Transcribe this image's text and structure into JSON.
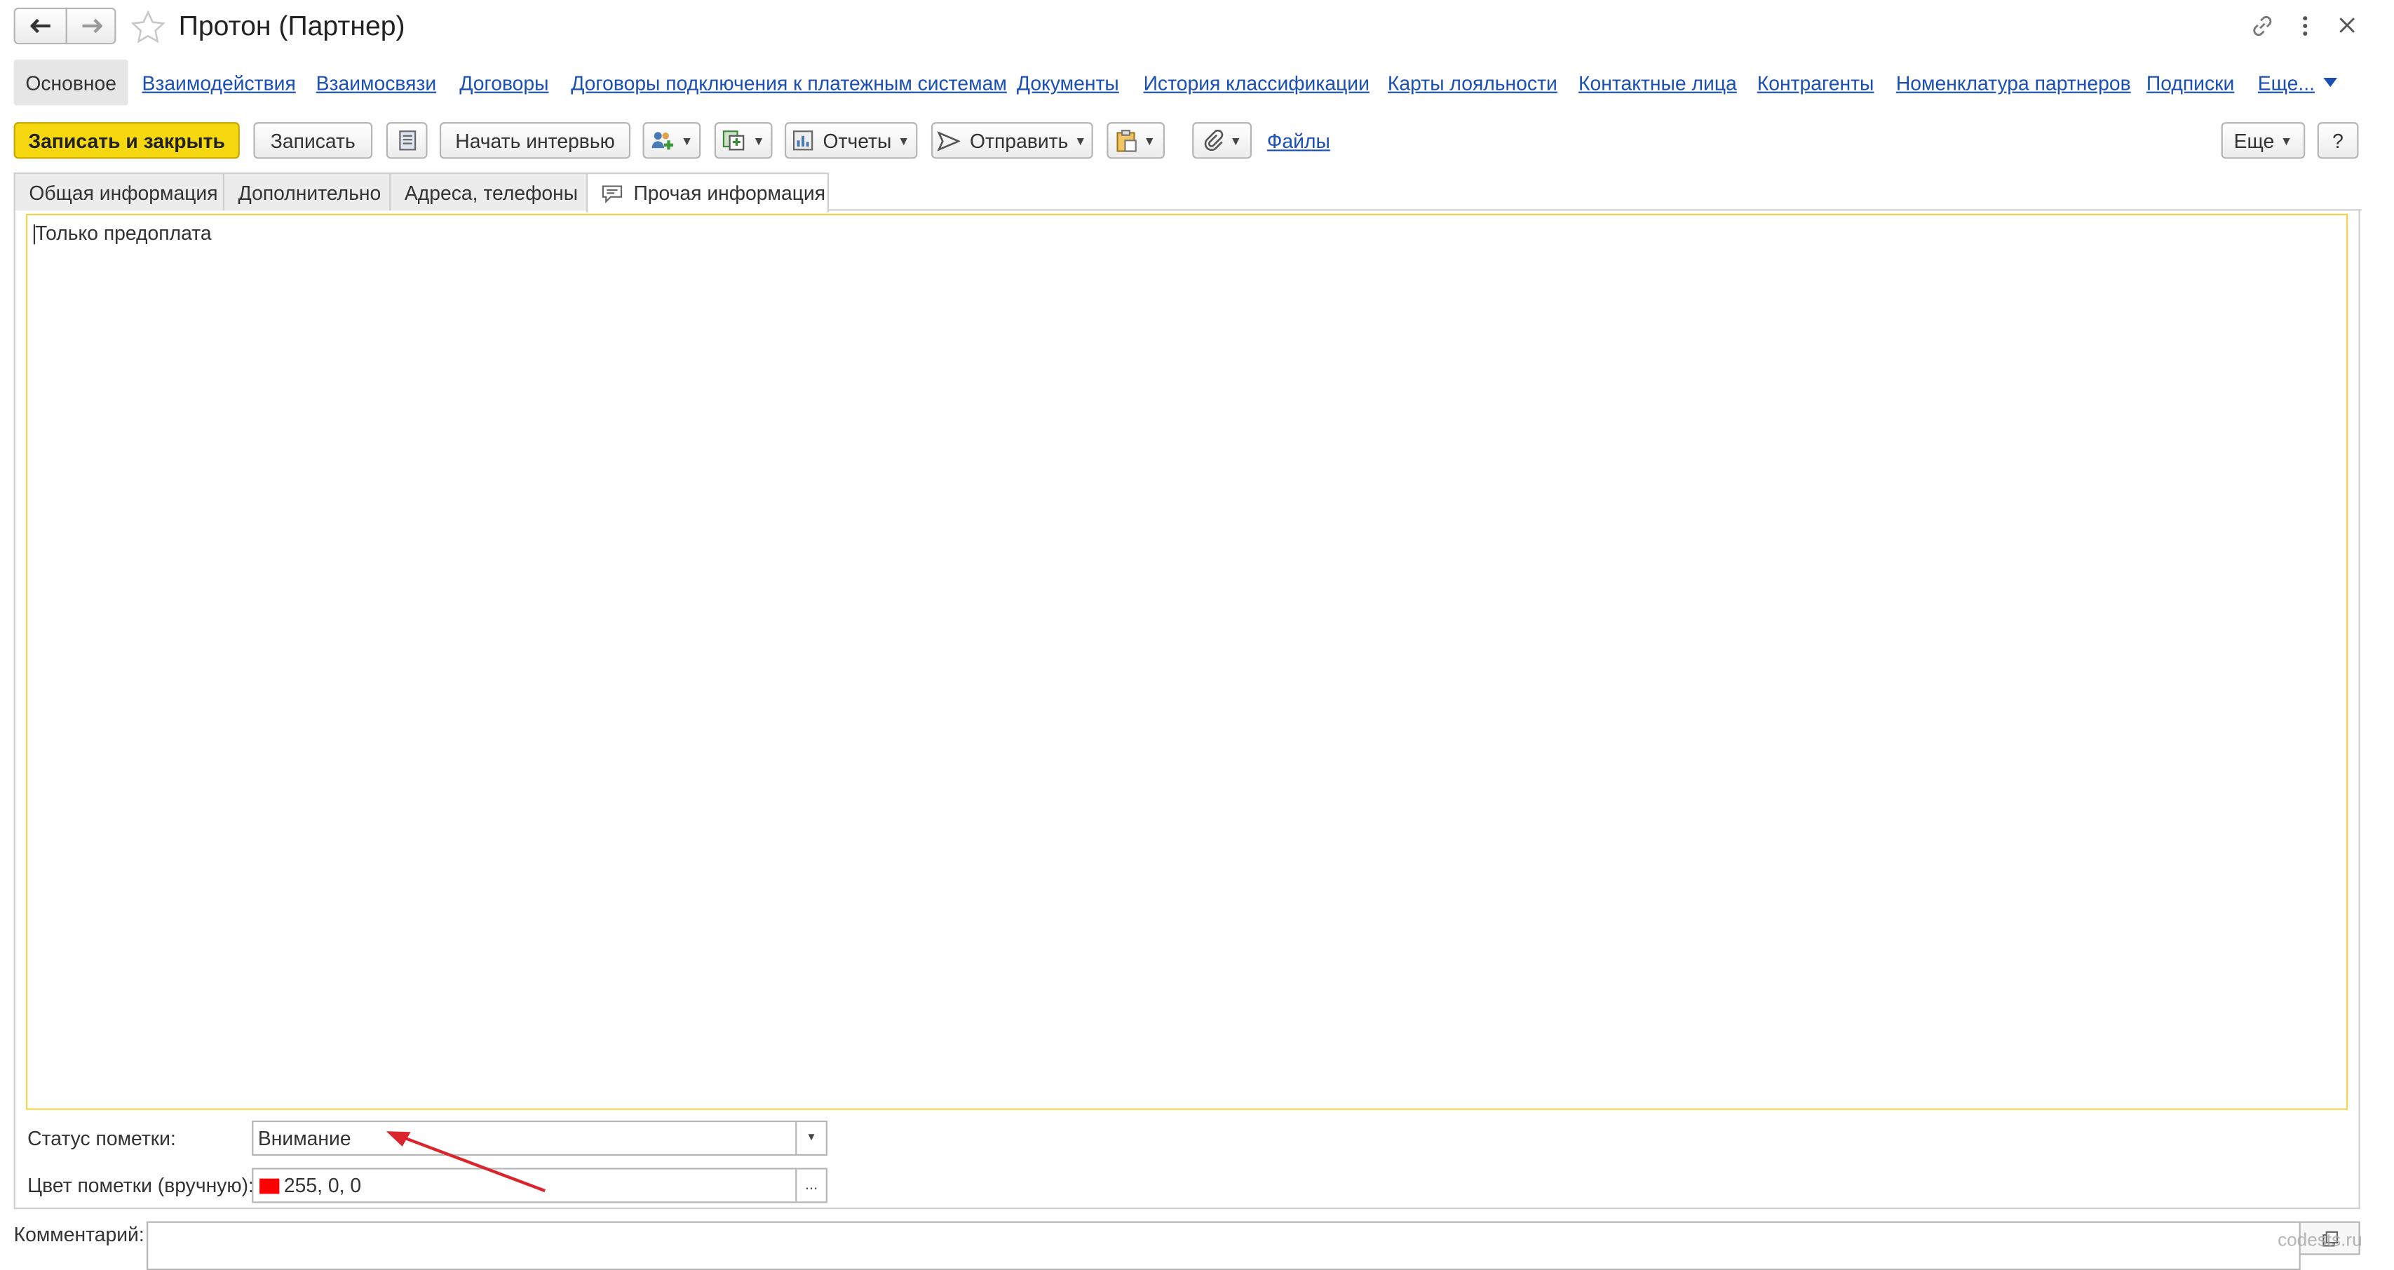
{
  "window": {
    "title": "Протон (Партнер)",
    "back_icon": "arrow-left-icon",
    "forward_icon": "arrow-right-icon",
    "favorite_icon": "star-icon",
    "link_icon": "link-icon",
    "menu_icon": "kebab-menu-icon",
    "close_icon": "close-icon"
  },
  "nav": {
    "active": "Основное",
    "links": [
      "Взаимодействия",
      "Взаимосвязи",
      "Договоры",
      "Договоры подключения к платежным системам",
      "Документы",
      "История классификации",
      "Карты лояльности",
      "Контактные лица",
      "Контрагенты",
      "Номенклатура партнеров",
      "Подписки",
      "Еще..."
    ]
  },
  "toolbar": {
    "save_close": "Записать и закрыть",
    "save": "Записать",
    "interview": "Начать интервью",
    "reports": "Отчеты",
    "send": "Отправить",
    "files": "Файлы",
    "more": "Еще",
    "help": "?"
  },
  "tabs": [
    "Общая информация",
    "Дополнительно",
    "Адреса, телефоны",
    "Прочая информация"
  ],
  "content": {
    "text": "Только предоплата",
    "status_label": "Статус пометки:",
    "status_value": "Внимание",
    "color_label": "Цвет пометки (вручную):",
    "color_value": "255, 0, 0",
    "color_swatch": "#ff0000",
    "comment_label": "Комментарий:"
  },
  "colors": {
    "accent_button": "#f5d80f",
    "link": "#1a50b5",
    "focus_border": "#f2d34b",
    "annotation_arrow": "#d9252b"
  },
  "watermark": "codests.ru"
}
